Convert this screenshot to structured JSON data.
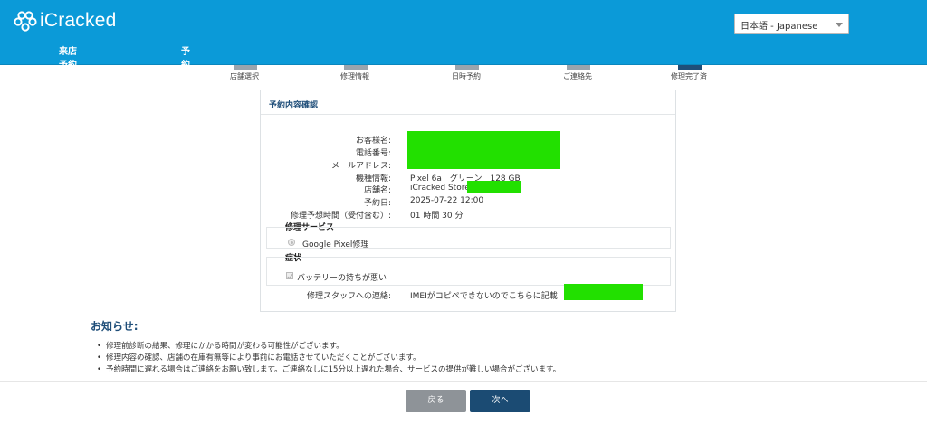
{
  "header": {
    "logo_text": "iCracked",
    "language": "日本語 - Japanese",
    "nav": [
      "来店予約照会・キャンセル",
      "予約する"
    ]
  },
  "steps": [
    {
      "label": "店舗選択",
      "active": false
    },
    {
      "label": "修理情報",
      "active": false
    },
    {
      "label": "日時予約",
      "active": false
    },
    {
      "label": "ご連絡先",
      "active": false
    },
    {
      "label": "修理完了済",
      "active": true
    }
  ],
  "confirmation": {
    "title": "予約内容確認",
    "rows": {
      "customer_name_label": "お客様名:",
      "phone_label": "電話番号:",
      "email_label": "メールアドレス:",
      "device_label": "機種情報:",
      "device_value": "Pixel 6a　グリーン　128 GB",
      "store_label": "店舗名:",
      "store_value": "iCracked Store",
      "date_label": "予約日:",
      "date_value": "2025-07-22 12:00",
      "duration_label": "修理予想時間（受付含む）:",
      "duration_value": "01 時間 30 分",
      "staff_note_label": "修理スタッフへの連絡:",
      "staff_note_value": "IMEIがコピペできないのでこちらに記載"
    },
    "service_section": {
      "title": "修理サービス",
      "option": "Google Pixel修理"
    },
    "symptom_section": {
      "title": "症状",
      "option": "バッテリーの持ちが悪い"
    }
  },
  "notice": {
    "title": "お知らせ:",
    "items": [
      "修理前診断の結果、修理にかかる時間が変わる可能性がございます。",
      "修理内容の確認、店舗の在庫有無等により事前にお電話させていただくことがございます。",
      "予約時間に遅れる場合はご連絡をお願い致します。ご連絡なしに15分以上遅れた場合、サービスの提供が難しい場合がございます。"
    ]
  },
  "buttons": {
    "back": "戻る",
    "next": "次へ"
  },
  "colors": {
    "header_bg": "#0b9ad8",
    "accent": "#1f4e79",
    "redaction": "#22e000"
  }
}
